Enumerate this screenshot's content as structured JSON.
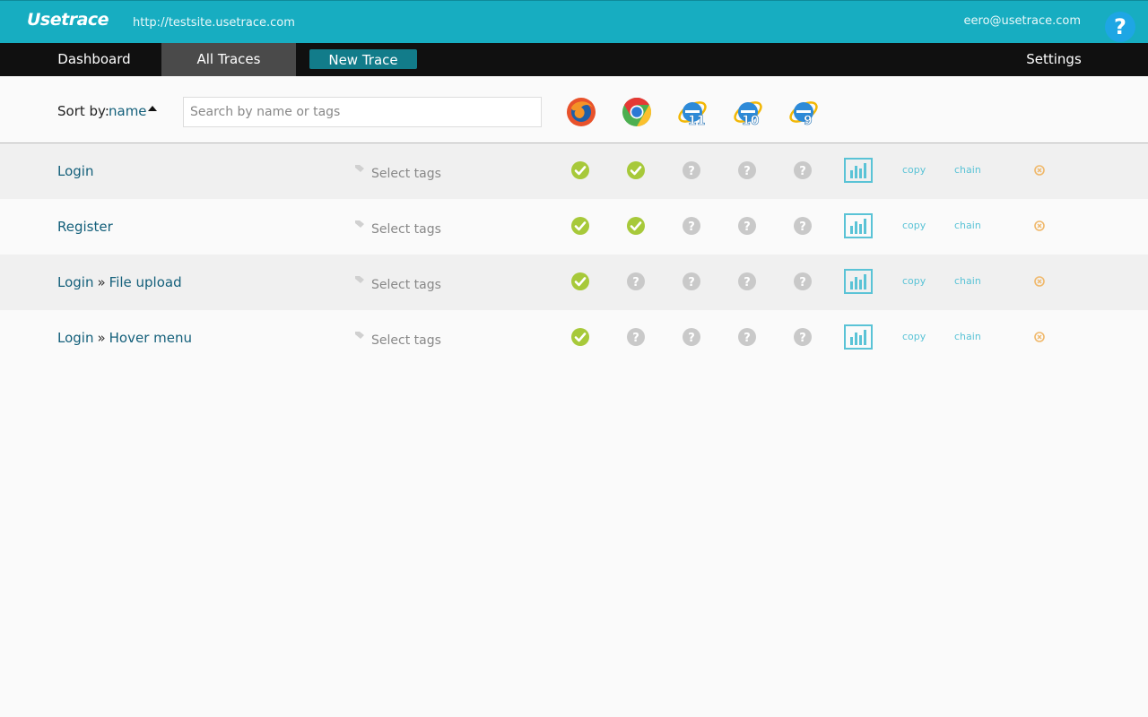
{
  "header": {
    "logo": "Usetrace",
    "site_url": "http://testsite.usetrace.com",
    "user_email": "eero@usetrace.com",
    "help_label": "?"
  },
  "nav": {
    "dashboard": "Dashboard",
    "all_traces": "All Traces",
    "new_trace": "New Trace",
    "settings": "Settings"
  },
  "toolbar": {
    "sort_label": "Sort by:",
    "sort_value": "name",
    "search_placeholder": "Search by name or tags",
    "browsers": [
      {
        "name": "firefox-icon"
      },
      {
        "name": "chrome-icon"
      },
      {
        "name": "ie11-icon",
        "version": "11"
      },
      {
        "name": "ie10-icon",
        "version": "10"
      },
      {
        "name": "ie9-icon",
        "version": "9"
      }
    ]
  },
  "traces": [
    {
      "parts": [
        "Login"
      ],
      "tags_placeholder": "Select tags",
      "statuses": [
        "pass",
        "pass",
        "unknown",
        "unknown",
        "unknown"
      ],
      "copy": "copy",
      "chain": "chain"
    },
    {
      "parts": [
        "Register"
      ],
      "tags_placeholder": "Select tags",
      "statuses": [
        "pass",
        "pass",
        "unknown",
        "unknown",
        "unknown"
      ],
      "copy": "copy",
      "chain": "chain"
    },
    {
      "parts": [
        "Login",
        "File upload"
      ],
      "tags_placeholder": "Select tags",
      "statuses": [
        "pass",
        "unknown",
        "unknown",
        "unknown",
        "unknown"
      ],
      "copy": "copy",
      "chain": "chain"
    },
    {
      "parts": [
        "Login",
        "Hover menu"
      ],
      "tags_placeholder": "Select tags",
      "statuses": [
        "pass",
        "unknown",
        "unknown",
        "unknown",
        "unknown"
      ],
      "copy": "copy",
      "chain": "chain"
    }
  ],
  "separator": "»",
  "colors": {
    "brand": "#17adc1",
    "pass": "#a7c93a",
    "unknown": "#c9c9c9",
    "link": "#135f7a",
    "delete": "#f0b86a"
  }
}
